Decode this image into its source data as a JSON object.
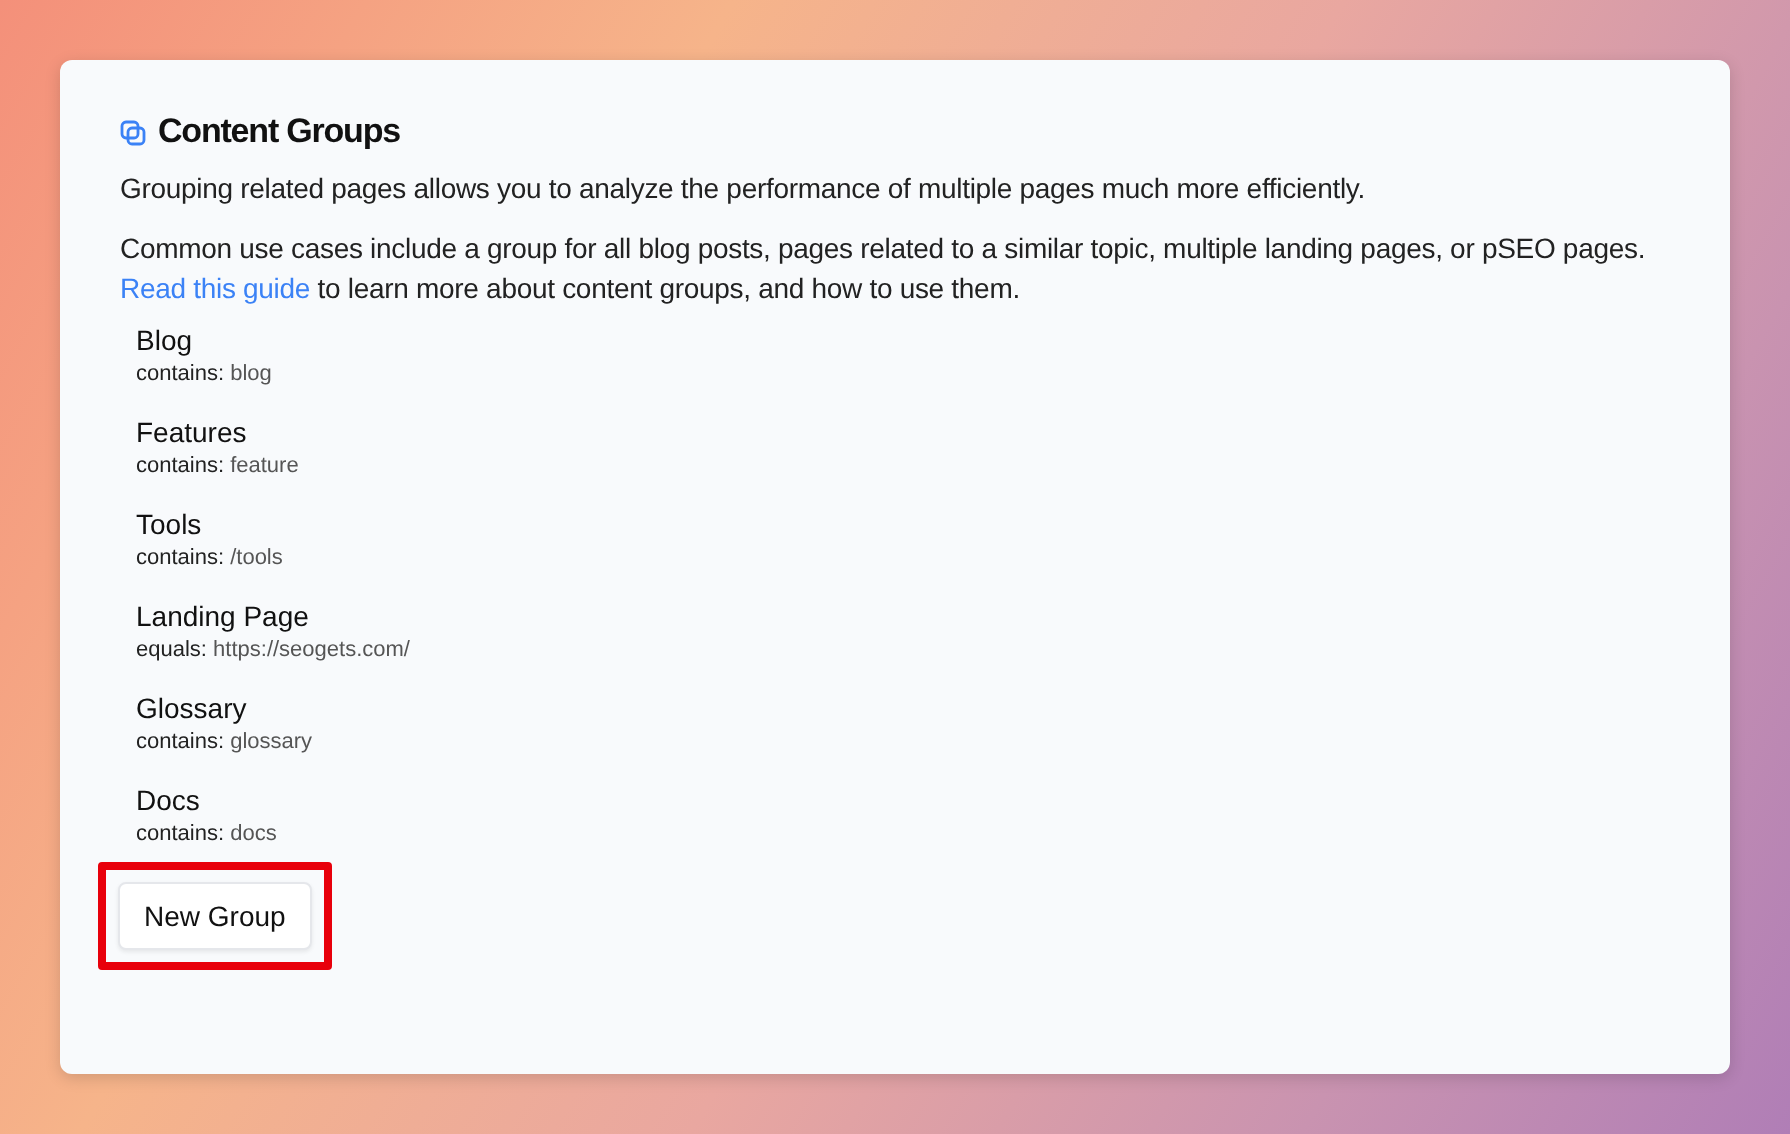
{
  "card": {
    "title": "Content Groups",
    "intro": "Grouping related pages allows you to analyze the performance of multiple pages much more efficiently.",
    "usage": "Common use cases include a group for all blog posts, pages related to a similar topic, multiple landing pages, or pSEO pages.",
    "guide_link": "Read this guide",
    "guide_rest": "to learn more about content groups, and how to use them."
  },
  "groups": [
    {
      "name": "Blog",
      "rule": "contains:",
      "value": "blog"
    },
    {
      "name": "Features",
      "rule": "contains:",
      "value": "feature"
    },
    {
      "name": "Tools",
      "rule": "contains:",
      "value": "/tools"
    },
    {
      "name": "Landing Page",
      "rule": "equals:",
      "value": "https://seogets.com/"
    },
    {
      "name": "Glossary",
      "rule": "contains:",
      "value": "glossary"
    },
    {
      "name": "Docs",
      "rule": "contains:",
      "value": "docs"
    }
  ],
  "new_group_button": {
    "label": "New Group",
    "highlighted": true
  }
}
